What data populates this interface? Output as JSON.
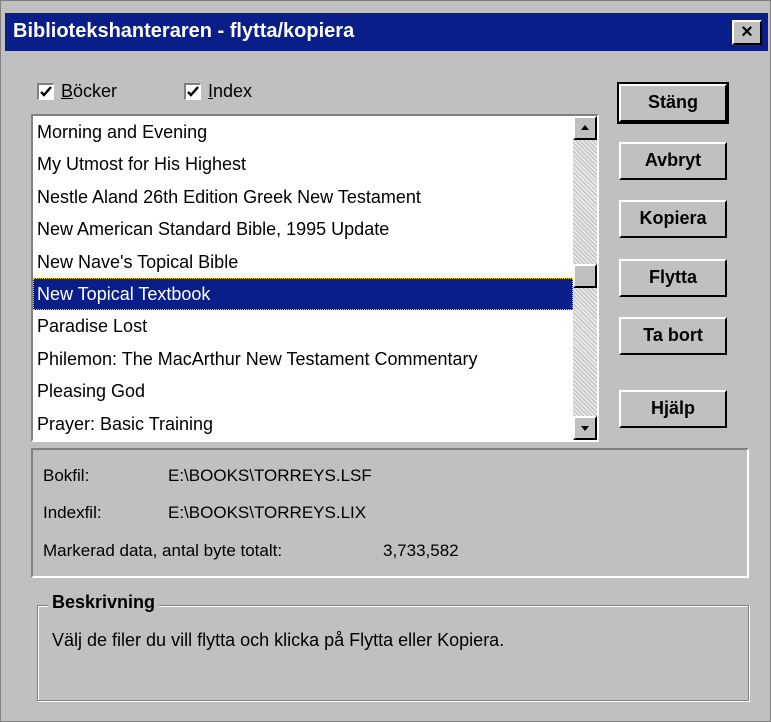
{
  "window": {
    "title": "Bibliotekshanteraren - flytta/kopiera",
    "close_label": "×"
  },
  "checkboxes": {
    "books": {
      "label": "Böcker",
      "checked": true
    },
    "index": {
      "label": "Index",
      "checked": true
    }
  },
  "list": {
    "items": [
      "Morning and Evening",
      "My Utmost for His Highest",
      "Nestle Aland 26th Edition Greek New Testament",
      "New American Standard Bible, 1995 Update",
      "New Nave's Topical Bible",
      "New Topical Textbook",
      "Paradise Lost",
      "Philemon: The MacArthur New Testament Commentary",
      "Pleasing God",
      "Prayer: Basic Training"
    ],
    "selected": "New Topical Textbook"
  },
  "buttons": {
    "close": "Stäng",
    "cancel": "Avbryt",
    "copy": "Kopiera",
    "move": "Flytta",
    "delete": "Ta bort",
    "help": "Hjälp"
  },
  "info": {
    "book_file_label": "Bokfil:",
    "book_file_value": "E:\\BOOKS\\TORREYS.LSF",
    "index_file_label": "Indexfil:",
    "index_file_value": "E:\\BOOKS\\TORREYS.LIX",
    "total_label": "Markerad data, antal byte totalt:",
    "total_value": "3,733,582"
  },
  "description": {
    "title": "Beskrivning",
    "text": "Välj de filer du vill flytta och klicka på Flytta eller Kopiera."
  },
  "colors": {
    "titlebar": "#0a1e8a",
    "face": "#c0c0c0",
    "selection": "#0a1e8a"
  }
}
